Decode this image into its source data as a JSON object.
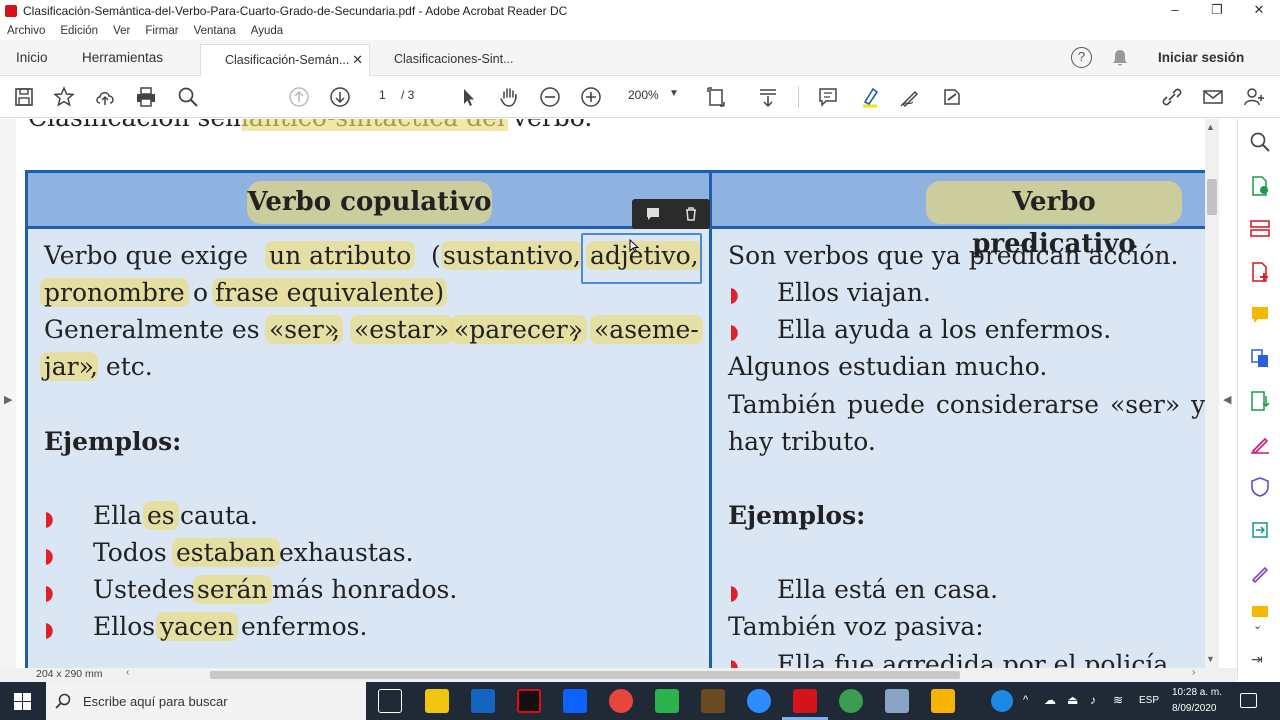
{
  "window": {
    "title": "Clasificación-Semántica-del-Verbo-Para-Cuarto-Grado-de-Secundaria.pdf - Adobe Acrobat Reader DC",
    "controls": [
      "–",
      "❐",
      "✕"
    ]
  },
  "menu": [
    "Archivo",
    "Edición",
    "Ver",
    "Firmar",
    "Ventana",
    "Ayuda"
  ],
  "tabs": {
    "home": "Inicio",
    "tools": "Herramientas",
    "doc1": "Clasificación-Semán...",
    "doc2": "Clasificaciones-Sint...",
    "doc_close": "✕",
    "signin": "Iniciar sesión"
  },
  "toolbar": {
    "page_current": "1",
    "page_total": "/ 3",
    "zoom": "200%"
  },
  "document": {
    "top_heading_partial": "Clasificación semántico-sintáctica del verbo.",
    "col1_header": "Verbo copulativo",
    "col2_header": "Verbo predicativo",
    "col1": {
      "l1a": "Verbo que exige",
      "l1b": "un atributo",
      "l1c": "(",
      "l1d": "sustantivo,",
      "l1e": "adjetivo,",
      "l2a": "pronombre",
      "l2b": "o",
      "l2c": "frase equivalente)",
      "l3a": "Generalmente es",
      "l3b": "«ser»",
      "l3c": ",",
      "l3d": "«estar»",
      "l3e": "«parecer»",
      "l3f": ",",
      "l3g": "«aseme-",
      "l4a": "jar»",
      "l4b": ", etc.",
      "examples_title": "Ejemplos:",
      "ex1a": "Ella",
      "ex1b": "es",
      "ex1c": "cauta.",
      "ex2a": "Todos",
      "ex2b": "estaban",
      "ex2c": "exhaustas.",
      "ex3a": "Ustedes",
      "ex3b": "serán",
      "ex3c": "más honrados.",
      "ex4a": "Ellos",
      "ex4b": "yacen",
      "ex4c": "enfermos."
    },
    "col2": {
      "l1": "Son verbos que ya predican acción.",
      "b1": "Ellos viajan.",
      "b2": "Ella ayuda a los enfermos.",
      "l4": "Algunos estudian mucho.",
      "l5": "También puede considerarse «ser» y",
      "l6": "hay tributo.",
      "examples_title": "Ejemplos:",
      "ex1": "Ella está en casa.",
      "l8": "También voz pasiva:",
      "l9_partial": "Ella fue agredida por el policía"
    }
  },
  "status": {
    "page_size": "204 x 290 mm"
  },
  "taskbar": {
    "search_placeholder": "Escribe aquí para buscar",
    "lang": "ESP",
    "time": "10:28 a. m.",
    "date": "8/09/2020"
  },
  "colors": {
    "acrobat_red": "#d4131b",
    "table_header_bg": "#8fb2e0",
    "table_body_bg": "#dbe6f4",
    "table_border": "#1d5fae",
    "highlight": "#ebdc78",
    "taskbar_bg": "#1f2a36"
  }
}
